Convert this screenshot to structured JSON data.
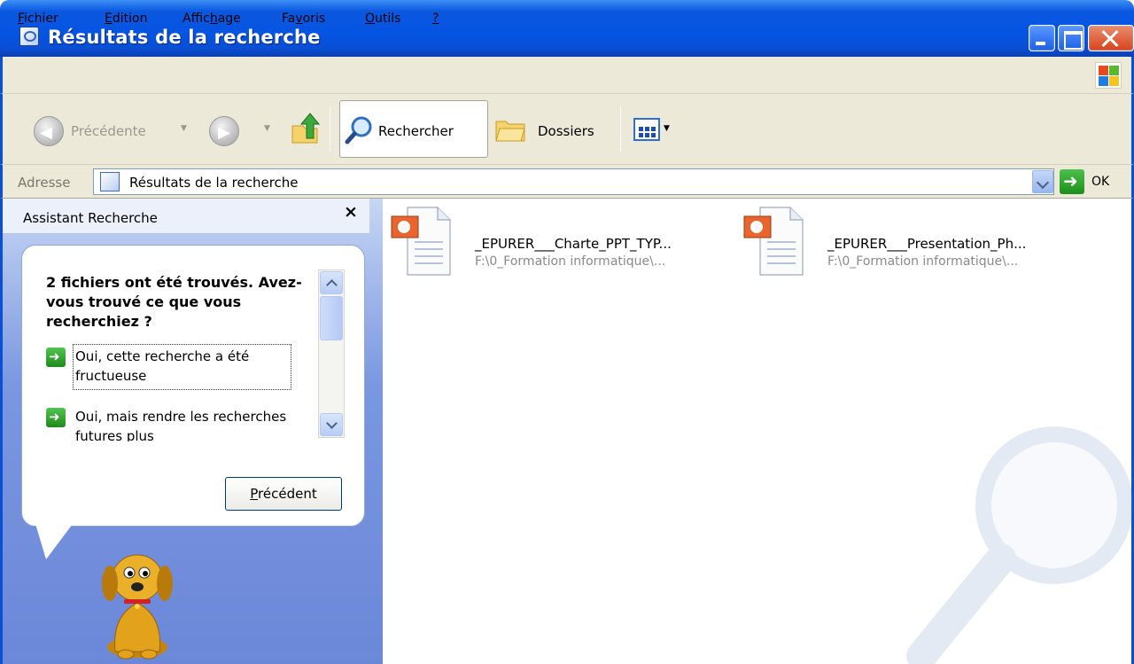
{
  "window": {
    "title": "Résultats de la recherche"
  },
  "menu": {
    "items": [
      {
        "pre": "",
        "ul": "F",
        "post": "ichier"
      },
      {
        "pre": "",
        "ul": "E",
        "post": "dition"
      },
      {
        "pre": "Affic",
        "ul": "h",
        "post": "age"
      },
      {
        "pre": "Fa",
        "ul": "v",
        "post": "oris"
      },
      {
        "pre": "",
        "ul": "O",
        "post": "utils"
      },
      {
        "pre": "",
        "ul": "?",
        "post": ""
      }
    ]
  },
  "toolbar": {
    "back_label": "Précédente",
    "search_label": "Rechercher",
    "folders_label": "Dossiers"
  },
  "address": {
    "label": "Adresse",
    "value": "Résultats de la recherche",
    "go_label": "OK"
  },
  "assistant": {
    "title": "Assistant Recherche",
    "close_glyph": "×",
    "question": "2 fichiers ont été trouvés. Avez-vous trouvé ce que vous recherchiez ?",
    "option1": "Oui, cette recherche a été fructueuse",
    "option2": "Oui, mais rendre les recherches futures plus",
    "back_pre": "",
    "back_ul": "P",
    "back_post": "récédent"
  },
  "results": [
    {
      "name": "_EPURER___Charte_PPT_TYP...",
      "path": "F:\\0_Formation informatique\\..."
    },
    {
      "name": "_EPURER___Presentation_Ph...",
      "path": "F:\\0_Formation informatique\\..."
    }
  ],
  "colors": {
    "titlebar": "#0554e2",
    "chrome": "#ece9d8",
    "pane": "#6b87d8"
  }
}
